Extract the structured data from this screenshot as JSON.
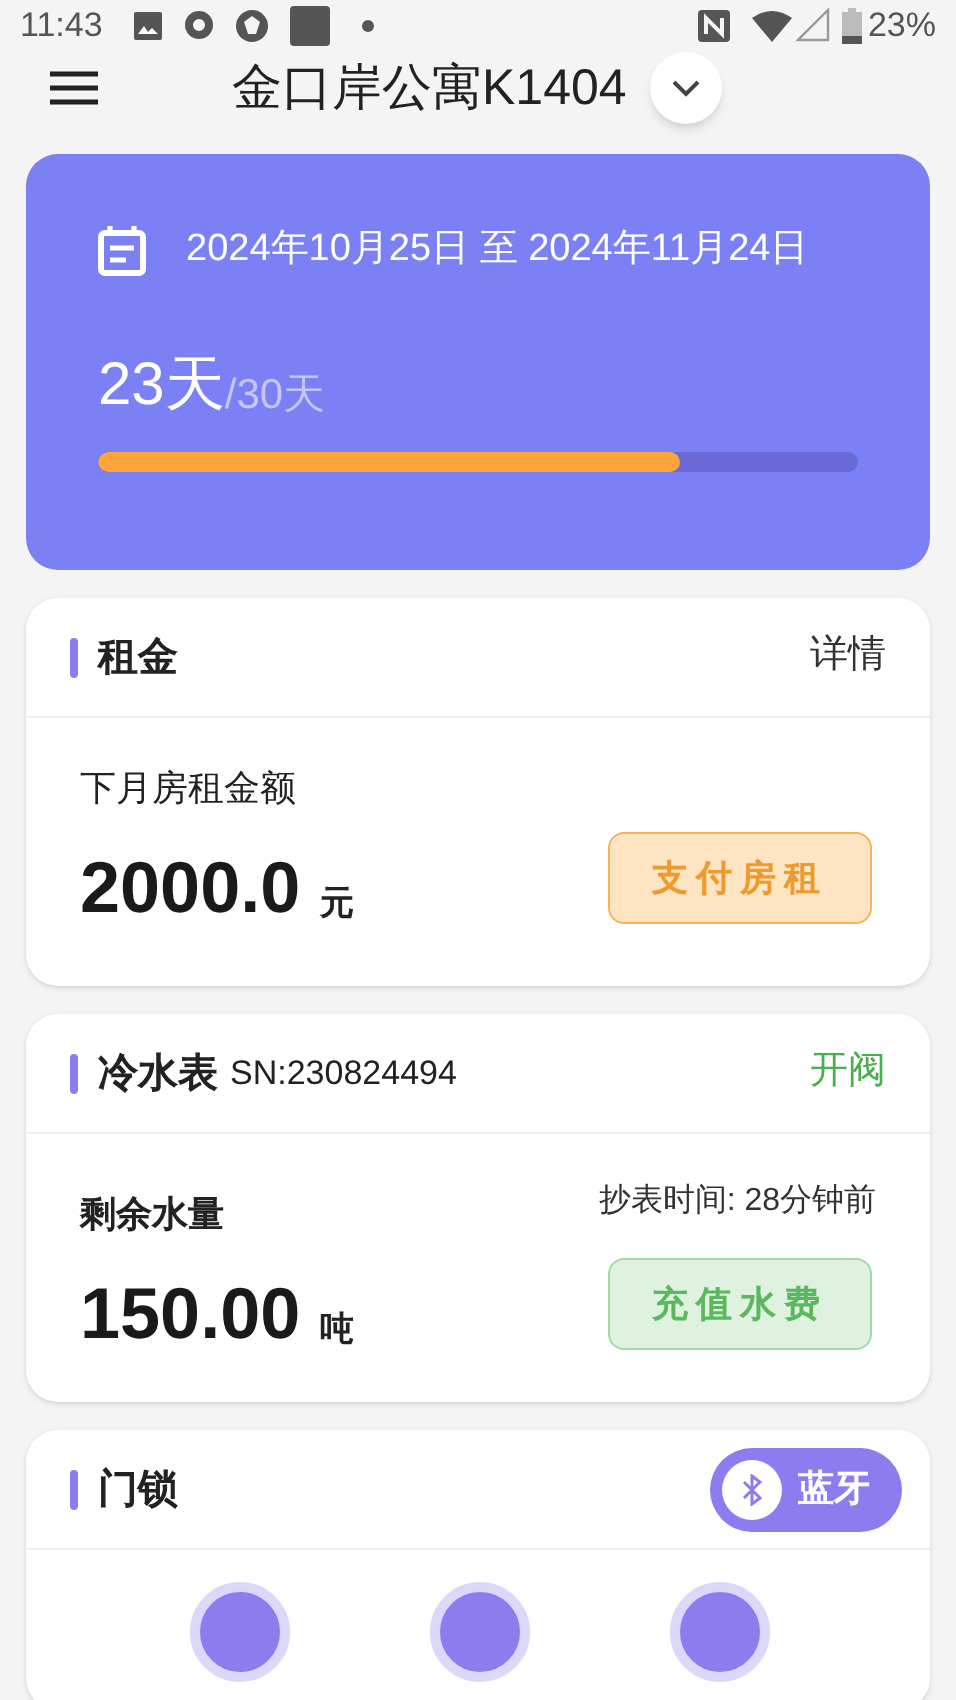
{
  "status_bar": {
    "time": "11:43",
    "battery": "23%"
  },
  "header": {
    "title": "金口岸公寓K1404"
  },
  "period": {
    "date_range": "2024年10月25日 至 2024年11月24日",
    "days_used": "23天",
    "days_total": "/30天",
    "level": 0.767
  },
  "rent": {
    "title": "租金",
    "link": "详情",
    "label": "下月房租金额",
    "amount": "2000.0",
    "unit": "元",
    "button": "支付房租"
  },
  "water": {
    "title": "冷水表",
    "sn": "SN:230824494",
    "action": "开阀",
    "label": "剩余水量",
    "read_time": "抄表时间: 28分钟前",
    "amount": "150.00",
    "unit": "吨",
    "button": "充值水费"
  },
  "lock": {
    "title": "门锁",
    "bluetooth": "蓝牙"
  }
}
